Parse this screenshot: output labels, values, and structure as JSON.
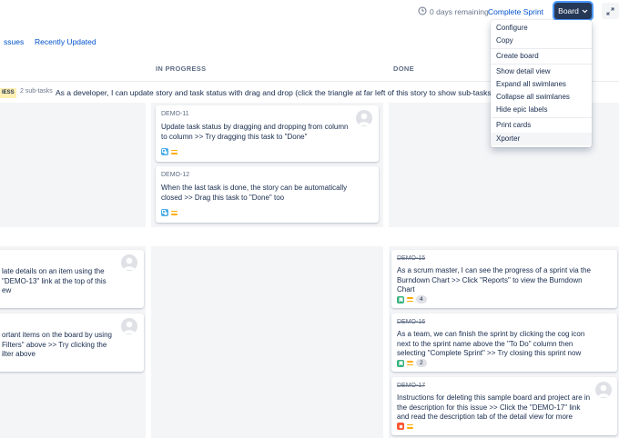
{
  "header": {
    "remaining": "0 days remaining",
    "complete_sprint": "Complete Sprint",
    "board_label": "Board"
  },
  "tabs": [
    "ssues",
    "Recently Updated"
  ],
  "columns": [
    "IN PROGRESS",
    "DONE"
  ],
  "swimlane": {
    "badge": "IESS",
    "subtasks": "2 sub-tasks",
    "title": "As a developer, I can update story and task status with drag and drop (click the triangle at far left of this story to show sub-tasks)"
  },
  "in_progress_cards": [
    {
      "key": "DEMO-11",
      "summary": [
        "Update task status by dragging and dropping from column",
        "to column >> Try dragging this task to \"Done\""
      ]
    },
    {
      "key": "DEMO-12",
      "summary": [
        "When the last task is done, the story can be automatically",
        "closed >> Drag this task to \"Done\" too"
      ]
    }
  ],
  "left_cards": [
    {
      "summary": [
        "late details on an item using the",
        "\"DEMO-13\" link at the top of this",
        "ew"
      ]
    },
    {
      "summary": [
        "ortant items on the board by using",
        "Filters\" above >> Try clicking the",
        "ilter above"
      ]
    }
  ],
  "done_cards": [
    {
      "key": "DEMO-15",
      "summary": [
        "As a scrum master, I can see the progress of a sprint via the",
        "Burndown Chart >> Click \"Reports\" to view the Burndown",
        "Chart"
      ],
      "count": "4"
    },
    {
      "key": "DEMO-16",
      "summary": [
        "As a team, we can finish the sprint by clicking the cog icon",
        "next to the sprint name above the \"To Do\" column then",
        "selecting \"Complete Sprint\" >> Try closing this sprint now"
      ],
      "count": "2"
    },
    {
      "key": "DEMO-17",
      "summary": [
        "Instructions for deleting this sample board and project are in",
        "the description for this issue >> Click the \"DEMO-17\" link",
        "and read the description tab of the detail view for more"
      ]
    }
  ],
  "menu": [
    "Configure",
    "Copy",
    "Create board",
    "Show detail view",
    "Expand all swimlanes",
    "Collapse all swimlanes",
    "Hide epic labels",
    "Print cards",
    "Xporter"
  ],
  "colors": {
    "primary": "#0052cc",
    "board_button": "#253858",
    "story": "#36b37e",
    "task": "#4bade8",
    "bug": "#ff5630",
    "priority": "#ffab00"
  }
}
